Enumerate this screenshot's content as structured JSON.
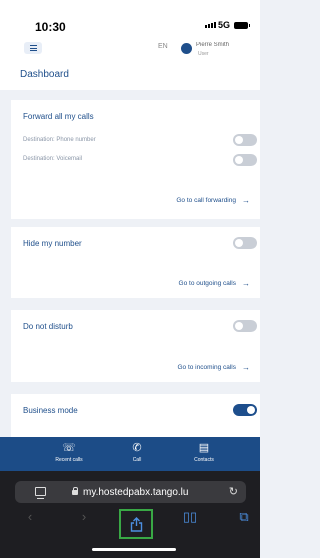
{
  "status_bar": {
    "time": "10:30",
    "network": "5G"
  },
  "header": {
    "language": "EN",
    "user_name": "Pierre Smith",
    "user_role": "User",
    "page_title": "Dashboard"
  },
  "forward": {
    "title": "Forward all my calls",
    "destinations": [
      {
        "label": "Destination: Phone number",
        "enabled": false
      },
      {
        "label": "Destination: Voicemail",
        "enabled": false
      }
    ],
    "link": "Go to call forwarding"
  },
  "hide_number": {
    "title": "Hide my number",
    "enabled": false,
    "link": "Go to outgoing calls"
  },
  "dnd": {
    "title": "Do not disturb",
    "enabled": false,
    "link": "Go to incoming calls"
  },
  "business": {
    "title": "Business mode",
    "enabled": true
  },
  "app_nav": [
    {
      "label": "Recent calls",
      "icon": "recent-calls-icon"
    },
    {
      "label": "Call",
      "icon": "phone-icon"
    },
    {
      "label": "Contacts",
      "icon": "contacts-icon"
    }
  ],
  "browser": {
    "url": "my.hostedpabx.tango.lu",
    "icons": [
      "back-icon",
      "forward-icon",
      "share-icon",
      "bookmarks-icon",
      "tabs-icon"
    ]
  },
  "colors": {
    "accent": "#1c4c87",
    "toggle_off": "#c9ced6",
    "highlight": "#39a845"
  }
}
